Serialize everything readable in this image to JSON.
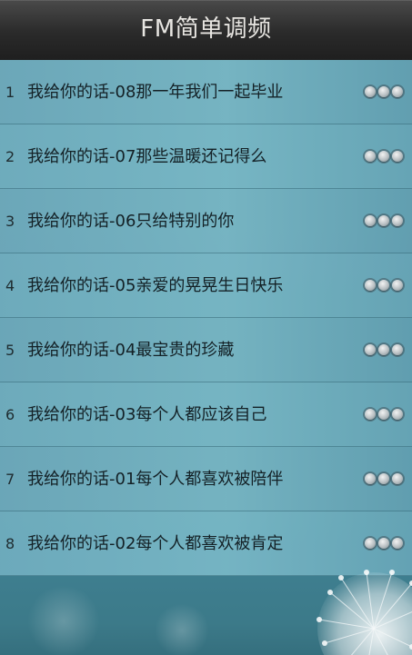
{
  "header": {
    "title": "FM简单调频"
  },
  "list": {
    "items": [
      {
        "index": "1",
        "title": "我给你的话-08那一年我们一起毕业"
      },
      {
        "index": "2",
        "title": "我给你的话-07那些温暖还记得么"
      },
      {
        "index": "3",
        "title": "我给你的话-06只给特别的你"
      },
      {
        "index": "4",
        "title": "我给你的话-05亲爱的晃晃生日快乐"
      },
      {
        "index": "5",
        "title": "我给你的话-04最宝贵的珍藏"
      },
      {
        "index": "6",
        "title": "我给你的话-03每个人都应该自己"
      },
      {
        "index": "7",
        "title": "我给你的话-01每个人都喜欢被陪伴"
      },
      {
        "index": "8",
        "title": "我给你的话-02每个人都喜欢被肯定"
      }
    ]
  },
  "icons": {
    "more": "more-dots-icon",
    "decoration": "dandelion-icon"
  }
}
